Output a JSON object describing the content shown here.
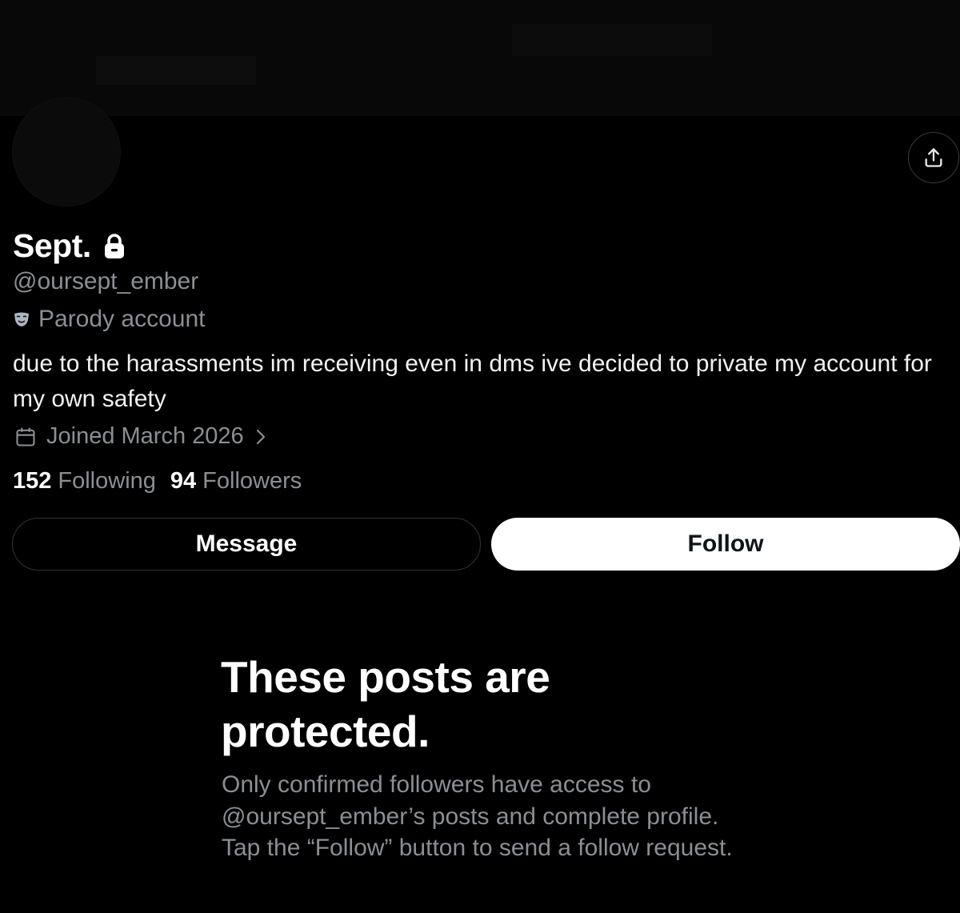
{
  "profile": {
    "display_name": "Sept.",
    "handle": "@oursept_ember",
    "parody_label": "Parody account",
    "bio": "due to the harassments im receiving even in dms ive decided to private my account for my own safety",
    "joined": "Joined March 2026",
    "following_count": "152",
    "following_label": "Following",
    "followers_count": "94",
    "followers_label": "Followers"
  },
  "actions": {
    "message_label": "Message",
    "follow_label": "Follow"
  },
  "protected": {
    "title": "These posts are protected.",
    "description": "Only confirmed followers have access to @oursept_ember’s posts and complete profile. Tap the “Follow” button to send a follow request."
  },
  "icons": {
    "share": "share-icon",
    "lock": "lock-icon",
    "parody": "mask-icon",
    "calendar": "calendar-icon",
    "chevron": "chevron-right-icon"
  },
  "colors": {
    "background": "#000000",
    "primary_text": "#ffffff",
    "secondary_text": "#8b8f94",
    "follow_button_bg": "#ffffff",
    "border": "#2f3336"
  }
}
